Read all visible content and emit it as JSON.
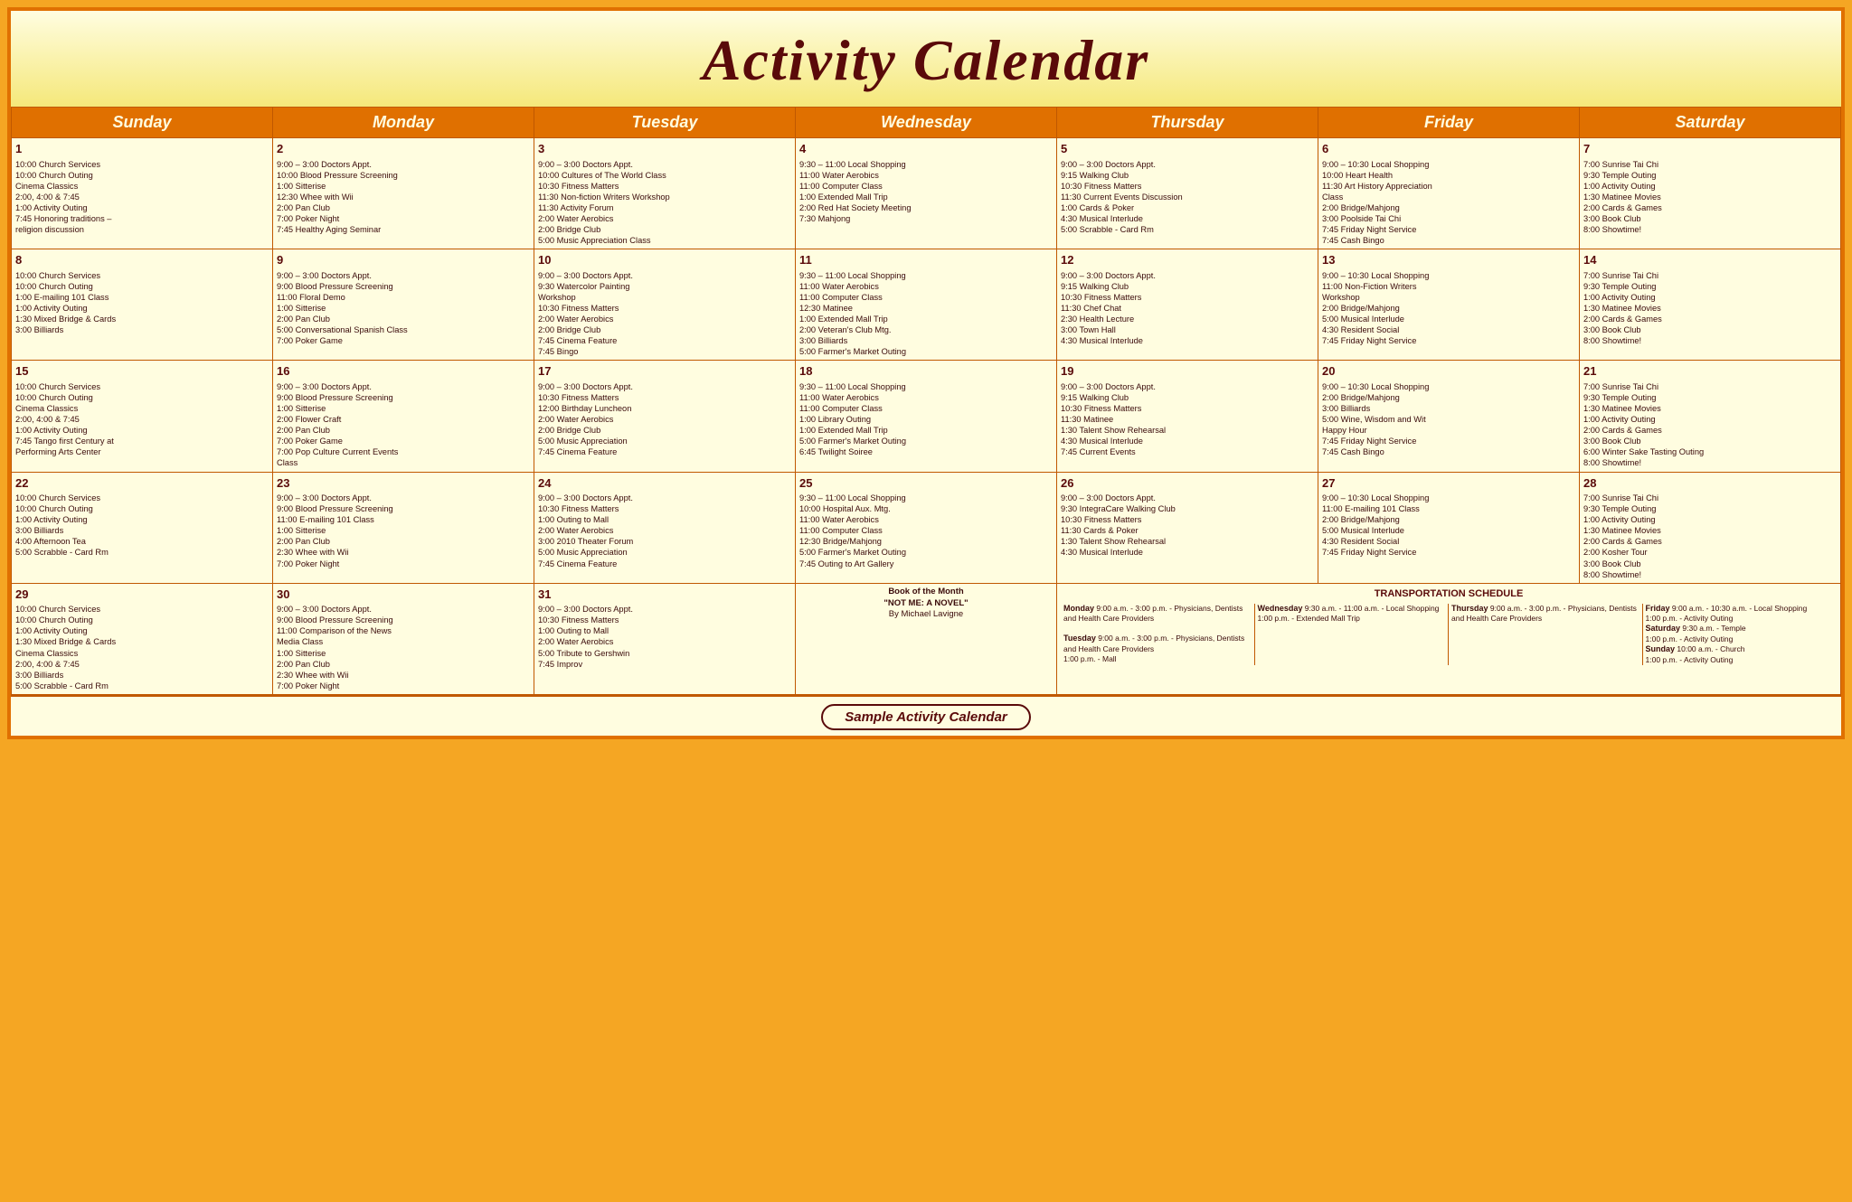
{
  "header": {
    "title": "Activity Calendar"
  },
  "days_of_week": [
    "Sunday",
    "Monday",
    "Tuesday",
    "Wednesday",
    "Thursday",
    "Friday",
    "Saturday"
  ],
  "footer": {
    "label": "Sample Activity Calendar"
  },
  "weeks": [
    {
      "cells": [
        {
          "day": 1,
          "events": [
            "10:00 Church Services",
            "10:00 Church Outing",
            "Cinema Classics",
            "2:00, 4:00 & 7:45",
            "1:00  Activity Outing",
            "7:45 Honoring traditions –",
            "religion discussion"
          ]
        },
        {
          "day": 2,
          "events": [
            "9:00  –  3:00 Doctors Appt.",
            "10:00 Blood Pressure Screening",
            "1:00 Sitterise",
            "12:30 Whee with Wii",
            "2:00 Pan Club",
            "7:00 Poker Night",
            "7:45 Healthy Aging Seminar"
          ]
        },
        {
          "day": 3,
          "events": [
            "9:00  –  3:00 Doctors Appt.",
            "10:00 Cultures of The World Class",
            "10:30 Fitness Matters",
            "11:30 Non-fiction Writers Workshop",
            "11:30 Activity Forum",
            "2:00 Water Aerobics",
            "2:00 Bridge Club",
            "5:00 Music Appreciation Class"
          ]
        },
        {
          "day": 4,
          "events": [
            "9:30 – 11:00 Local Shopping",
            "11:00 Water Aerobics",
            "11:00 Computer Class",
            "1:00 Extended Mall Trip",
            "2:00 Red Hat Society Meeting",
            "7:30 Mahjong"
          ]
        },
        {
          "day": 5,
          "events": [
            "9:00  –  3:00 Doctors Appt.",
            "9:15 Walking Club",
            "10:30 Fitness Matters",
            "11:30 Current Events Discussion",
            "1:00 Cards & Poker",
            "4:30 Musical Interlude",
            "5:00 Scrabble - Card Rm"
          ]
        },
        {
          "day": 6,
          "events": [
            "9:00  –  10:30 Local Shopping",
            "10:00 Heart Health",
            "11:30 Art History Appreciation",
            "Class",
            "2:00 Bridge/Mahjong",
            "3:00 Poolside Tai Chi",
            "7:45 Friday Night Service",
            "7:45 Cash Bingo"
          ]
        },
        {
          "day": 7,
          "events": [
            "7:00 Sunrise Tai Chi",
            "9:30  Temple Outing",
            "1:00  Activity Outing",
            "1:30 Matinee Movies",
            "2:00 Cards & Games",
            "3:00 Book Club",
            "8:00 Showtime!"
          ]
        }
      ]
    },
    {
      "cells": [
        {
          "day": 8,
          "events": [
            "10:00 Church Services",
            "10:00 Church Outing",
            "1:00 E-mailing 101 Class",
            "1:00  Activity Outing",
            "1:30 Mixed Bridge & Cards",
            "3:00 Billiards"
          ]
        },
        {
          "day": 9,
          "events": [
            "9:00  –  3:00 Doctors Appt.",
            "9:00 Blood Pressure Screening",
            "11:00 Floral Demo",
            "1:00 Sitterise",
            "2:00 Pan Club",
            "5:00 Conversational Spanish Class",
            "7:00 Poker Game"
          ]
        },
        {
          "day": 10,
          "events": [
            "9:00  –  3:00 Doctors Appt.",
            "9:30 Watercolor Painting",
            "Workshop",
            "10:30 Fitness Matters",
            "2:00 Water Aerobics",
            "2:00 Bridge Club",
            "7:45 Cinema Feature",
            "7:45 Bingo"
          ]
        },
        {
          "day": 11,
          "events": [
            "9:30 – 11:00 Local Shopping",
            "11:00 Water Aerobics",
            "11:00 Computer Class",
            "12:30 Matinee",
            "1:00 Extended Mall Trip",
            "2:00 Veteran's Club Mtg.",
            "3:00 Billiards",
            "5:00 Farmer's Market Outing"
          ]
        },
        {
          "day": 12,
          "events": [
            "9:00  –  3:00 Doctors Appt.",
            "9:15 Walking Club",
            "10:30 Fitness Matters",
            "11:30 Chef Chat",
            "2:30 Health Lecture",
            "3:00 Town Hall",
            "4:30 Musical Interlude"
          ]
        },
        {
          "day": 13,
          "events": [
            "9:00  –  10:30 Local Shopping",
            "11:00 Non-Fiction Writers",
            "Workshop",
            "2:00 Bridge/Mahjong",
            "5:00 Musical Interlude",
            "4:30 Resident Social",
            "7:45 Friday Night Service"
          ]
        },
        {
          "day": 14,
          "events": [
            "7:00 Sunrise Tai Chi",
            "9:30  Temple Outing",
            "1:00  Activity Outing",
            "1:30 Matinee Movies",
            "2:00 Cards & Games",
            "3:00 Book Club",
            "8:00 Showtime!"
          ]
        }
      ]
    },
    {
      "cells": [
        {
          "day": 15,
          "events": [
            "10:00 Church Services",
            "10:00 Church Outing",
            "Cinema Classics",
            "2:00, 4:00 & 7:45",
            "1:00  Activity Outing",
            "7:45 Tango first Century at",
            "Performing Arts Center"
          ]
        },
        {
          "day": 16,
          "events": [
            "9:00  –  3:00 Doctors Appt.",
            "9:00 Blood Pressure Screening",
            "1:00 Sitterise",
            "2:00 Flower Craft",
            "2:00 Pan Club",
            "7:00 Poker Game",
            "7:00 Pop Culture Current Events",
            "Class"
          ]
        },
        {
          "day": 17,
          "events": [
            "9:00  –  3:00 Doctors Appt.",
            "10:30 Fitness Matters",
            "12:00 Birthday Luncheon",
            "2:00 Water Aerobics",
            "2:00 Bridge Club",
            "5:00 Music Appreciation",
            "7:45 Cinema Feature"
          ]
        },
        {
          "day": 18,
          "events": [
            "9:30 – 11:00 Local Shopping",
            "11:00 Water Aerobics",
            "11:00 Computer Class",
            "1:00 Library Outing",
            "1:00 Extended Mall Trip",
            "5:00 Farmer's Market Outing",
            "6:45 Twilight Soiree"
          ]
        },
        {
          "day": 19,
          "events": [
            "9:00  –  3:00 Doctors Appt.",
            "9:15 Walking Club",
            "10:30 Fitness Matters",
            "11:30 Matinee",
            "1:30 Talent Show Rehearsal",
            "4:30 Musical Interlude",
            "7:45 Current Events"
          ]
        },
        {
          "day": 20,
          "events": [
            "9:00  –  10:30 Local Shopping",
            "2:00 Bridge/Mahjong",
            "3:00 Billiards",
            "5:00 Wine, Wisdom and Wit",
            "Happy Hour",
            "7:45 Friday Night Service",
            "7:45 Cash Bingo"
          ]
        },
        {
          "day": 21,
          "events": [
            "7:00 Sunrise Tai Chi",
            "9:30  Temple Outing",
            "1:30 Matinee Movies",
            "1:00  Activity Outing",
            "2:00 Cards & Games",
            "3:00 Book Club",
            "6:00 Winter Sake Tasting Outing",
            "8:00 Showtime!"
          ]
        }
      ]
    },
    {
      "cells": [
        {
          "day": 22,
          "events": [
            "10:00 Church Services",
            "10:00 Church Outing",
            "1:00  Activity Outing",
            "3:00 Billiards",
            "4:00 Afternoon Tea",
            "5:00 Scrabble - Card Rm"
          ]
        },
        {
          "day": 23,
          "events": [
            "9:00  –  3:00 Doctors Appt.",
            "9:00 Blood Pressure Screening",
            "11:00 E-mailing 101 Class",
            "1:00 Sitterise",
            "2:00 Pan Club",
            "2:30 Whee with Wii",
            "7:00 Poker Night"
          ]
        },
        {
          "day": 24,
          "events": [
            "9:00  –  3:00 Doctors Appt.",
            "10:30 Fitness Matters",
            "1:00 Outing to Mall",
            "2:00 Water Aerobics",
            "3:00 2010 Theater Forum",
            "5:00 Music Appreciation",
            "7:45 Cinema Feature"
          ]
        },
        {
          "day": 25,
          "events": [
            "9:30 – 11:00 Local Shopping",
            "10:00 Hospital Aux. Mtg.",
            "11:00 Water Aerobics",
            "11:00 Computer Class",
            "12:30 Bridge/Mahjong",
            "5:00 Farmer's Market Outing",
            "7:45 Outing to Art Gallery"
          ]
        },
        {
          "day": 26,
          "events": [
            "9:00  –  3:00 Doctors Appt.",
            "9:30 IntegraCare Walking Club",
            "10:30 Fitness Matters",
            "11:30 Cards & Poker",
            "1:30 Talent Show Rehearsal",
            "4:30 Musical Interlude"
          ]
        },
        {
          "day": 27,
          "events": [
            "9:00  –  10:30 Local Shopping",
            "11:00 E-mailing 101 Class",
            "2:00 Bridge/Mahjong",
            "5:00 Musical Interlude",
            "4:30 Resident Social",
            "7:45 Friday Night Service"
          ]
        },
        {
          "day": 28,
          "events": [
            "7:00 Sunrise Tai Chi",
            "9:30  Temple Outing",
            "1:00  Activity Outing",
            "1:30 Matinee Movies",
            "2:00 Cards & Games",
            "2:00 Kosher Tour",
            "3:00 Book Club",
            "8:00 Showtime!"
          ]
        }
      ]
    },
    {
      "cells": [
        {
          "day": 29,
          "events": [
            "10:00 Church Services",
            "10:00 Church Outing",
            "1:00  Activity Outing",
            "1:30 Mixed Bridge & Cards",
            "Cinema Classics",
            "2:00, 4:00 & 7:45",
            "3:00 Billiards",
            "5:00 Scrabble - Card Rm"
          ]
        },
        {
          "day": 30,
          "events": [
            "9:00  –  3:00 Doctors Appt.",
            "9:00 Blood Pressure Screening",
            "11:00 Comparison of the News",
            "Media Class",
            "1:00 Sitterise",
            "2:00 Pan Club",
            "2:30 Whee with Wii",
            "7:00 Poker Night"
          ]
        },
        {
          "day": 31,
          "events": [
            "9:00  –  3:00 Doctors Appt.",
            "10:30 Fitness Matters",
            "1:00 Outing to Mall",
            "2:00 Water Aerobics",
            "5:00 Tribute to Gershwin",
            "7:45 Improv"
          ]
        },
        {
          "book_of_month": true,
          "book_title": "Book of the Month",
          "book_name": "\"NOT ME: A NOVEL\"",
          "book_author": "By Michael Lavigne"
        },
        {
          "transport_row": true
        }
      ]
    }
  ],
  "transport": {
    "title": "TRANSPORTATION SCHEDULE",
    "monday": {
      "label": "Monday",
      "text": "9:00 a.m. - 3:00 p.m. - Physicians, Dentists and Health Care Providers"
    },
    "tuesday": {
      "label": "Tuesday",
      "text": "9:00 a.m. - 3:00 p.m. - Physicians, Dentists and Health Care Providers\n1:00 p.m. - Mall"
    },
    "wednesday": {
      "label": "Wednesday",
      "text": "9:30 a.m. - 11:00 a.m. - Local Shopping\n1:00 p.m. - Extended Mall Trip"
    },
    "thursday": {
      "label": "Thursday",
      "text": "9:00 a.m. - 3:00 p.m. - Physicians, Dentists and Health Care Providers"
    },
    "friday": {
      "label": "Friday",
      "text": "9:00 a.m. - 10:30 a.m. - Local Shopping\n1:00 p.m. - Activity Outing"
    },
    "saturday": {
      "label": "Saturday",
      "text": "9:30 a.m. - Temple\n1:00 p.m. - Activity Outing"
    },
    "sunday": {
      "label": "Sunday",
      "text": "10:00 a.m. - Church\n1:00 p.m. - Activity Outing"
    }
  }
}
